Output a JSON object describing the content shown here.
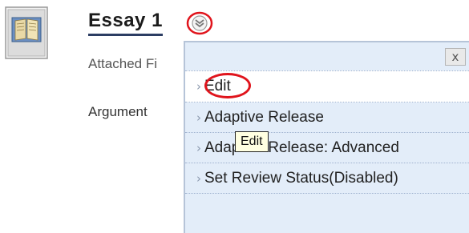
{
  "item": {
    "title": "Essay 1",
    "attached_label": "Attached Fi",
    "argument_label": "Argument",
    "icon": "assignment-book-icon"
  },
  "menu": {
    "trigger_icon": "chevron-down-circle-icon",
    "close_label": "x",
    "items": [
      {
        "label": "Edit",
        "icon": "right-arrow-icon"
      },
      {
        "label": "Adaptive Release",
        "icon": "right-arrow-icon"
      },
      {
        "label": "Adaptive Release: Advanced",
        "icon": "right-arrow-icon"
      },
      {
        "label": "Set Review Status(Disabled)",
        "icon": "right-arrow-icon"
      }
    ]
  },
  "tooltip": {
    "text": "Edit"
  },
  "colors": {
    "menu_bg": "#e3edf9",
    "highlight_circle": "#e0141c",
    "title_underline": "#2c3d63",
    "tooltip_bg": "#ffffe1"
  }
}
